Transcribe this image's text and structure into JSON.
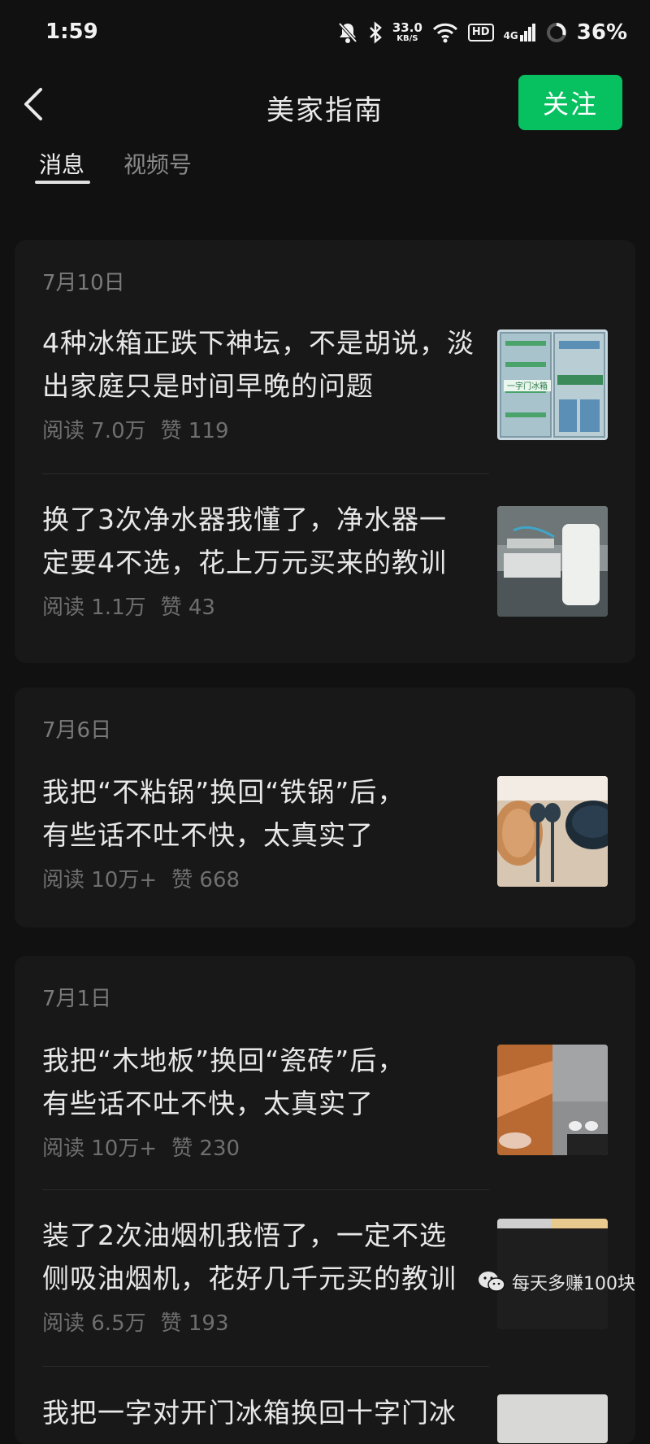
{
  "status_bar": {
    "time": "1:59",
    "speed_value": "33.0",
    "speed_unit": "KB/S",
    "hd": "HD",
    "network": "4G",
    "battery": "36%"
  },
  "header": {
    "title": "美家指南",
    "follow_label": "关注"
  },
  "tabs": [
    {
      "label": "消息"
    },
    {
      "label": "视频号"
    }
  ],
  "groups": [
    {
      "date": "7月10日",
      "articles": [
        {
          "title_line1": "4种冰箱正跌下神坛，不是胡说，淡",
          "title_line2": "出家庭只是时间早晚的问题",
          "reads": "阅读 7.0万",
          "likes": "赞 119",
          "thumb_text": "一字门冰箱"
        },
        {
          "title_line1": "换了3次净水器我懂了，净水器一",
          "title_line2": "定要4不选，花上万元买来的教训",
          "reads": "阅读 1.1万",
          "likes": "赞 43"
        }
      ]
    },
    {
      "date": "7月6日",
      "articles": [
        {
          "title_line1": "我把“不粘锅”换回“铁锅”后，",
          "title_line2": "有些话不吐不快，太真实了",
          "reads": "阅读 10万+",
          "likes": "赞 668"
        }
      ]
    },
    {
      "date": "7月1日",
      "articles": [
        {
          "title_line1": "我把“木地板”换回“瓷砖”后，",
          "title_line2": "有些话不吐不快，太真实了",
          "reads": "阅读 10万+",
          "likes": "赞 230"
        },
        {
          "title_line1": "装了2次油烟机我悟了，一定不选",
          "title_line2": "侧吸油烟机，花好几千元买的教训",
          "reads": "阅读 6.5万",
          "likes": "赞 193"
        },
        {
          "title_line1": "我把一字对开门冰箱换回十字门冰"
        }
      ]
    }
  ],
  "watermark": {
    "text": "每天多赚100块"
  }
}
